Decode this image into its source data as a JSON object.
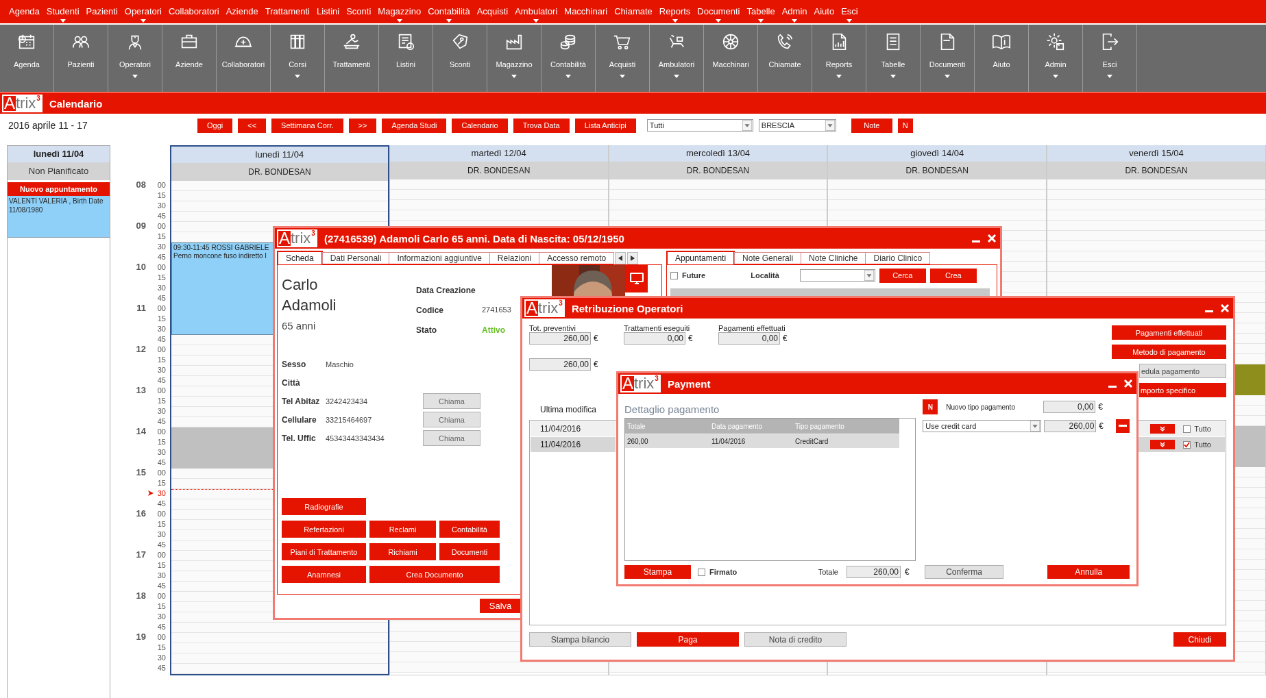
{
  "menu": [
    {
      "label": "Agenda",
      "dropdown": false
    },
    {
      "label": "Studenti",
      "dropdown": true
    },
    {
      "label": "Pazienti",
      "dropdown": false
    },
    {
      "label": "Operatori",
      "dropdown": true
    },
    {
      "label": "Collaboratori",
      "dropdown": false
    },
    {
      "label": "Aziende",
      "dropdown": false
    },
    {
      "label": "Trattamenti",
      "dropdown": false
    },
    {
      "label": "Listini",
      "dropdown": false
    },
    {
      "label": "Sconti",
      "dropdown": false
    },
    {
      "label": "Magazzino",
      "dropdown": true
    },
    {
      "label": "Contabilità",
      "dropdown": true
    },
    {
      "label": "Acquisti",
      "dropdown": false
    },
    {
      "label": "Ambulatori",
      "dropdown": true
    },
    {
      "label": "Macchinari",
      "dropdown": false
    },
    {
      "label": "Chiamate",
      "dropdown": false
    },
    {
      "label": "Reports",
      "dropdown": true
    },
    {
      "label": "Documenti",
      "dropdown": true
    },
    {
      "label": "Tabelle",
      "dropdown": true
    },
    {
      "label": "Admin",
      "dropdown": true
    },
    {
      "label": "Aiuto",
      "dropdown": false
    },
    {
      "label": "Esci",
      "dropdown": true
    }
  ],
  "toolbar": [
    {
      "label": "Agenda",
      "dropdown": false
    },
    {
      "label": "Pazienti",
      "dropdown": false
    },
    {
      "label": "Operatori",
      "dropdown": true
    },
    {
      "label": "Aziende",
      "dropdown": false
    },
    {
      "label": "Collaboratori",
      "dropdown": false
    },
    {
      "label": "Corsi",
      "dropdown": true
    },
    {
      "label": "Trattamenti",
      "dropdown": false
    },
    {
      "label": "Listini",
      "dropdown": false
    },
    {
      "label": "Sconti",
      "dropdown": false
    },
    {
      "label": "Magazzino",
      "dropdown": true
    },
    {
      "label": "Contabilità",
      "dropdown": true
    },
    {
      "label": "Acquisti",
      "dropdown": true
    },
    {
      "label": "Ambulatori",
      "dropdown": true
    },
    {
      "label": "Macchinari",
      "dropdown": false
    },
    {
      "label": "Chiamate",
      "dropdown": false
    },
    {
      "label": "Reports",
      "dropdown": true
    },
    {
      "label": "Tabelle",
      "dropdown": true
    },
    {
      "label": "Documenti",
      "dropdown": true
    },
    {
      "label": "Aiuto",
      "dropdown": false
    },
    {
      "label": "Admin",
      "dropdown": true
    },
    {
      "label": "Esci",
      "dropdown": true
    }
  ],
  "app_bar": {
    "logo": {
      "initial": "A",
      "rest": "trix",
      "mark": "3"
    },
    "title": "Calendario"
  },
  "calendar": {
    "range": "2016 aprile 11 - 17",
    "buttons": [
      "Oggi",
      "<<",
      "Settimana Corr.",
      ">>",
      "Agenda Studi",
      "Calendario",
      "Trova Data",
      "Lista Anticipi"
    ],
    "filters": [
      "Tutti",
      "BRESCIA"
    ],
    "extra_buttons": [
      "Note",
      "N"
    ],
    "unplanned": {
      "day": "lunedì 11/04",
      "title": "Non Pianificato",
      "new_button": "Nuovo appuntamento",
      "entries": [
        "VALENTI VALERIA , Birth Date 11/08/1980"
      ]
    },
    "days": [
      {
        "day": "lunedì 11/04",
        "doctor": "DR. BONDESAN",
        "selected": true,
        "appointments": [
          {
            "time": "09:30-11:45",
            "patient": "ROSSI GABRIELE",
            "note": "Perno moncone fuso indiretto l"
          }
        ]
      },
      {
        "day": "martedì 12/04",
        "doctor": "DR. BONDESAN",
        "selected": false
      },
      {
        "day": "mercoledì 13/04",
        "doctor": "DR. BONDESAN",
        "selected": false
      },
      {
        "day": "giovedì 14/04",
        "doctor": "DR. BONDESAN",
        "selected": false
      },
      {
        "day": "venerdì 15/04",
        "doctor": "DR. BONDESAN",
        "selected": false
      }
    ],
    "slots": [
      {
        "hour": "08",
        "minute": "00",
        "now": false
      },
      {
        "minute": "15",
        "now": false
      },
      {
        "minute": "30",
        "now": false
      },
      {
        "minute": "45",
        "now": false
      },
      {
        "hour": "09",
        "minute": "00",
        "now": false
      },
      {
        "minute": "15",
        "now": false
      },
      {
        "minute": "30",
        "now": false
      },
      {
        "minute": "45",
        "now": false
      },
      {
        "hour": "10",
        "minute": "00",
        "now": false
      },
      {
        "minute": "15",
        "now": false
      },
      {
        "minute": "30",
        "now": false
      },
      {
        "minute": "45",
        "now": false
      },
      {
        "hour": "11",
        "minute": "00",
        "now": false
      },
      {
        "minute": "15",
        "now": false
      },
      {
        "minute": "30",
        "now": false
      },
      {
        "minute": "45",
        "now": false
      },
      {
        "hour": "12",
        "minute": "00",
        "now": false
      },
      {
        "minute": "15",
        "now": false
      },
      {
        "minute": "30",
        "now": false
      },
      {
        "minute": "45",
        "now": false
      },
      {
        "hour": "13",
        "minute": "00",
        "now": false
      },
      {
        "minute": "15",
        "now": false
      },
      {
        "minute": "30",
        "now": false
      },
      {
        "minute": "45",
        "now": false
      },
      {
        "hour": "14",
        "minute": "00",
        "now": false
      },
      {
        "minute": "15",
        "now": false
      },
      {
        "minute": "30",
        "now": false
      },
      {
        "minute": "45",
        "now": false
      },
      {
        "hour": "15",
        "minute": "00",
        "now": false
      },
      {
        "minute": "15",
        "now": false
      },
      {
        "minute": "30",
        "now": true
      },
      {
        "minute": "45",
        "now": false
      },
      {
        "hour": "16",
        "minute": "00",
        "now": false
      },
      {
        "minute": "15",
        "now": false
      },
      {
        "minute": "30",
        "now": false
      },
      {
        "minute": "45",
        "now": false
      },
      {
        "hour": "17",
        "minute": "00",
        "now": false
      },
      {
        "minute": "15",
        "now": false
      },
      {
        "minute": "30",
        "now": false
      },
      {
        "minute": "45",
        "now": false
      },
      {
        "hour": "18",
        "minute": "00",
        "now": false
      },
      {
        "minute": "15",
        "now": false
      },
      {
        "minute": "30",
        "now": false
      },
      {
        "minute": "45",
        "now": false
      },
      {
        "hour": "19",
        "minute": "00",
        "now": false
      },
      {
        "minute": "15",
        "now": false
      },
      {
        "minute": "30",
        "now": false
      },
      {
        "minute": "45",
        "now": false
      }
    ]
  },
  "patient_window": {
    "logo": {
      "initial": "A",
      "rest": "trix",
      "mark": "3"
    },
    "title": "(27416539) Adamoli Carlo 65 anni. Data di Nascita: 05/12/1950",
    "tabs": [
      {
        "label": "Scheda",
        "selected": true
      },
      {
        "label": "Dati Personali",
        "selected": false
      },
      {
        "label": "Informazioni aggiuntive",
        "selected": false
      },
      {
        "label": "Relazioni",
        "selected": false
      },
      {
        "label": "Accesso remoto",
        "selected": false
      }
    ],
    "first_name": "Carlo",
    "last_name": "Adamoli",
    "age": "65 anni",
    "info": [
      {
        "label": "Data Creazione"
      },
      {
        "label": "Codice",
        "value": "2741653"
      },
      {
        "label": "Stato",
        "value": "Attivo"
      }
    ],
    "fields": [
      {
        "label": "Sesso",
        "value": "Maschio"
      },
      {
        "label": "Città"
      },
      {
        "label": "Tel Abitaz",
        "value": "3242423434",
        "button": "Chiama"
      },
      {
        "label": "Cellulare",
        "value": "33215464697",
        "button": "Chiama"
      },
      {
        "label": "Tel. Uffic",
        "value": "45343443343434",
        "button": "Chiama"
      }
    ],
    "actions": [
      [
        "Radiografie"
      ],
      [
        "Refertazioni",
        "Reclami",
        "Contabilità"
      ],
      [
        "Piani di Trattamento",
        "Richiami",
        "Documenti"
      ],
      [
        "Anamnesi",
        "Crea Documento"
      ]
    ],
    "save": "Salva",
    "side_tabs": [
      {
        "label": "Appuntamenti",
        "selected": true
      },
      {
        "label": "Note Generali",
        "selected": false
      },
      {
        "label": "Note Cliniche",
        "selected": false
      },
      {
        "label": "Diario Clinico",
        "selected": false
      }
    ],
    "future": {
      "label": "Future",
      "checked": false
    },
    "location_label": "Località",
    "side_buttons": [
      "Cerca",
      "Crea"
    ]
  },
  "payroll_window": {
    "logo": {
      "initial": "A",
      "rest": "trix",
      "mark": "3"
    },
    "title": "Retribuzione Operatori",
    "totals": [
      {
        "label": "Tot. preventivi",
        "value": "260,00",
        "currency": "€"
      },
      {
        "label": "Trattamenti eseguiti",
        "value": "0,00",
        "currency": "€"
      },
      {
        "label": "Pagamenti effettuati",
        "value": "0,00",
        "currency": "€"
      }
    ],
    "balance": {
      "value": "260,00",
      "currency": "€"
    },
    "side_buttons": [
      {
        "label": "Pagamenti effettuati",
        "kind": "primary"
      },
      {
        "label": "Metodo di pagamento",
        "kind": "primary"
      },
      {
        "label": "edula pagamento",
        "kind": "secondary"
      },
      {
        "label": "mporto specifico",
        "kind": "primary"
      }
    ],
    "history_label": "Ultima modifica",
    "history": [
      {
        "date": "11/04/2016",
        "selected": false,
        "all_label": "Tutto",
        "all_checked": false
      },
      {
        "date": "11/04/2016",
        "selected": true,
        "all_label": "Tutto",
        "all_checked": true
      }
    ],
    "footer": [
      {
        "label": "Stampa bilancio",
        "kind": "secondary"
      },
      {
        "label": "Paga",
        "kind": "primary"
      },
      {
        "label": "Nota di credito",
        "kind": "secondary"
      }
    ],
    "close": "Chiudi"
  },
  "payment_window": {
    "logo": {
      "initial": "A",
      "rest": "trix",
      "mark": "3"
    },
    "title": "Payment",
    "section": "Dettaglio pagamento",
    "columns": [
      "Totale",
      "Data pagamento",
      "Tipo pagamento"
    ],
    "rows": [
      [
        "260,00",
        "11/04/2016",
        "CreditCard"
      ]
    ],
    "new_type_icon": "N",
    "new_type_label": "Nuovo tipo pagamento",
    "new_amount": {
      "value": "0,00",
      "currency": "€"
    },
    "method": "Use credit card",
    "method_amount": {
      "value": "260,00",
      "currency": "€"
    },
    "print": "Stampa",
    "signed": {
      "label": "Firmato",
      "checked": false
    },
    "total_label": "Totale",
    "total": {
      "value": "260,00",
      "currency": "€"
    },
    "confirm": "Conferma",
    "cancel": "Annulla"
  }
}
